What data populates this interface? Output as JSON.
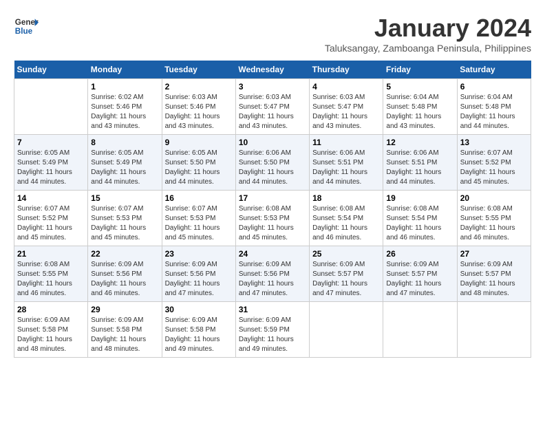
{
  "header": {
    "logo_general": "General",
    "logo_blue": "Blue",
    "month_title": "January 2024",
    "location": "Taluksangay, Zamboanga Peninsula, Philippines"
  },
  "weekdays": [
    "Sunday",
    "Monday",
    "Tuesday",
    "Wednesday",
    "Thursday",
    "Friday",
    "Saturday"
  ],
  "weeks": [
    [
      {
        "day": "",
        "sunrise": "",
        "sunset": "",
        "daylight": ""
      },
      {
        "day": "1",
        "sunrise": "Sunrise: 6:02 AM",
        "sunset": "Sunset: 5:46 PM",
        "daylight": "Daylight: 11 hours and 43 minutes."
      },
      {
        "day": "2",
        "sunrise": "Sunrise: 6:03 AM",
        "sunset": "Sunset: 5:46 PM",
        "daylight": "Daylight: 11 hours and 43 minutes."
      },
      {
        "day": "3",
        "sunrise": "Sunrise: 6:03 AM",
        "sunset": "Sunset: 5:47 PM",
        "daylight": "Daylight: 11 hours and 43 minutes."
      },
      {
        "day": "4",
        "sunrise": "Sunrise: 6:03 AM",
        "sunset": "Sunset: 5:47 PM",
        "daylight": "Daylight: 11 hours and 43 minutes."
      },
      {
        "day": "5",
        "sunrise": "Sunrise: 6:04 AM",
        "sunset": "Sunset: 5:48 PM",
        "daylight": "Daylight: 11 hours and 43 minutes."
      },
      {
        "day": "6",
        "sunrise": "Sunrise: 6:04 AM",
        "sunset": "Sunset: 5:48 PM",
        "daylight": "Daylight: 11 hours and 44 minutes."
      }
    ],
    [
      {
        "day": "7",
        "sunrise": "Sunrise: 6:05 AM",
        "sunset": "Sunset: 5:49 PM",
        "daylight": "Daylight: 11 hours and 44 minutes."
      },
      {
        "day": "8",
        "sunrise": "Sunrise: 6:05 AM",
        "sunset": "Sunset: 5:49 PM",
        "daylight": "Daylight: 11 hours and 44 minutes."
      },
      {
        "day": "9",
        "sunrise": "Sunrise: 6:05 AM",
        "sunset": "Sunset: 5:50 PM",
        "daylight": "Daylight: 11 hours and 44 minutes."
      },
      {
        "day": "10",
        "sunrise": "Sunrise: 6:06 AM",
        "sunset": "Sunset: 5:50 PM",
        "daylight": "Daylight: 11 hours and 44 minutes."
      },
      {
        "day": "11",
        "sunrise": "Sunrise: 6:06 AM",
        "sunset": "Sunset: 5:51 PM",
        "daylight": "Daylight: 11 hours and 44 minutes."
      },
      {
        "day": "12",
        "sunrise": "Sunrise: 6:06 AM",
        "sunset": "Sunset: 5:51 PM",
        "daylight": "Daylight: 11 hours and 44 minutes."
      },
      {
        "day": "13",
        "sunrise": "Sunrise: 6:07 AM",
        "sunset": "Sunset: 5:52 PM",
        "daylight": "Daylight: 11 hours and 45 minutes."
      }
    ],
    [
      {
        "day": "14",
        "sunrise": "Sunrise: 6:07 AM",
        "sunset": "Sunset: 5:52 PM",
        "daylight": "Daylight: 11 hours and 45 minutes."
      },
      {
        "day": "15",
        "sunrise": "Sunrise: 6:07 AM",
        "sunset": "Sunset: 5:53 PM",
        "daylight": "Daylight: 11 hours and 45 minutes."
      },
      {
        "day": "16",
        "sunrise": "Sunrise: 6:07 AM",
        "sunset": "Sunset: 5:53 PM",
        "daylight": "Daylight: 11 hours and 45 minutes."
      },
      {
        "day": "17",
        "sunrise": "Sunrise: 6:08 AM",
        "sunset": "Sunset: 5:53 PM",
        "daylight": "Daylight: 11 hours and 45 minutes."
      },
      {
        "day": "18",
        "sunrise": "Sunrise: 6:08 AM",
        "sunset": "Sunset: 5:54 PM",
        "daylight": "Daylight: 11 hours and 46 minutes."
      },
      {
        "day": "19",
        "sunrise": "Sunrise: 6:08 AM",
        "sunset": "Sunset: 5:54 PM",
        "daylight": "Daylight: 11 hours and 46 minutes."
      },
      {
        "day": "20",
        "sunrise": "Sunrise: 6:08 AM",
        "sunset": "Sunset: 5:55 PM",
        "daylight": "Daylight: 11 hours and 46 minutes."
      }
    ],
    [
      {
        "day": "21",
        "sunrise": "Sunrise: 6:08 AM",
        "sunset": "Sunset: 5:55 PM",
        "daylight": "Daylight: 11 hours and 46 minutes."
      },
      {
        "day": "22",
        "sunrise": "Sunrise: 6:09 AM",
        "sunset": "Sunset: 5:56 PM",
        "daylight": "Daylight: 11 hours and 46 minutes."
      },
      {
        "day": "23",
        "sunrise": "Sunrise: 6:09 AM",
        "sunset": "Sunset: 5:56 PM",
        "daylight": "Daylight: 11 hours and 47 minutes."
      },
      {
        "day": "24",
        "sunrise": "Sunrise: 6:09 AM",
        "sunset": "Sunset: 5:56 PM",
        "daylight": "Daylight: 11 hours and 47 minutes."
      },
      {
        "day": "25",
        "sunrise": "Sunrise: 6:09 AM",
        "sunset": "Sunset: 5:57 PM",
        "daylight": "Daylight: 11 hours and 47 minutes."
      },
      {
        "day": "26",
        "sunrise": "Sunrise: 6:09 AM",
        "sunset": "Sunset: 5:57 PM",
        "daylight": "Daylight: 11 hours and 47 minutes."
      },
      {
        "day": "27",
        "sunrise": "Sunrise: 6:09 AM",
        "sunset": "Sunset: 5:57 PM",
        "daylight": "Daylight: 11 hours and 48 minutes."
      }
    ],
    [
      {
        "day": "28",
        "sunrise": "Sunrise: 6:09 AM",
        "sunset": "Sunset: 5:58 PM",
        "daylight": "Daylight: 11 hours and 48 minutes."
      },
      {
        "day": "29",
        "sunrise": "Sunrise: 6:09 AM",
        "sunset": "Sunset: 5:58 PM",
        "daylight": "Daylight: 11 hours and 48 minutes."
      },
      {
        "day": "30",
        "sunrise": "Sunrise: 6:09 AM",
        "sunset": "Sunset: 5:58 PM",
        "daylight": "Daylight: 11 hours and 49 minutes."
      },
      {
        "day": "31",
        "sunrise": "Sunrise: 6:09 AM",
        "sunset": "Sunset: 5:59 PM",
        "daylight": "Daylight: 11 hours and 49 minutes."
      },
      {
        "day": "",
        "sunrise": "",
        "sunset": "",
        "daylight": ""
      },
      {
        "day": "",
        "sunrise": "",
        "sunset": "",
        "daylight": ""
      },
      {
        "day": "",
        "sunrise": "",
        "sunset": "",
        "daylight": ""
      }
    ]
  ]
}
